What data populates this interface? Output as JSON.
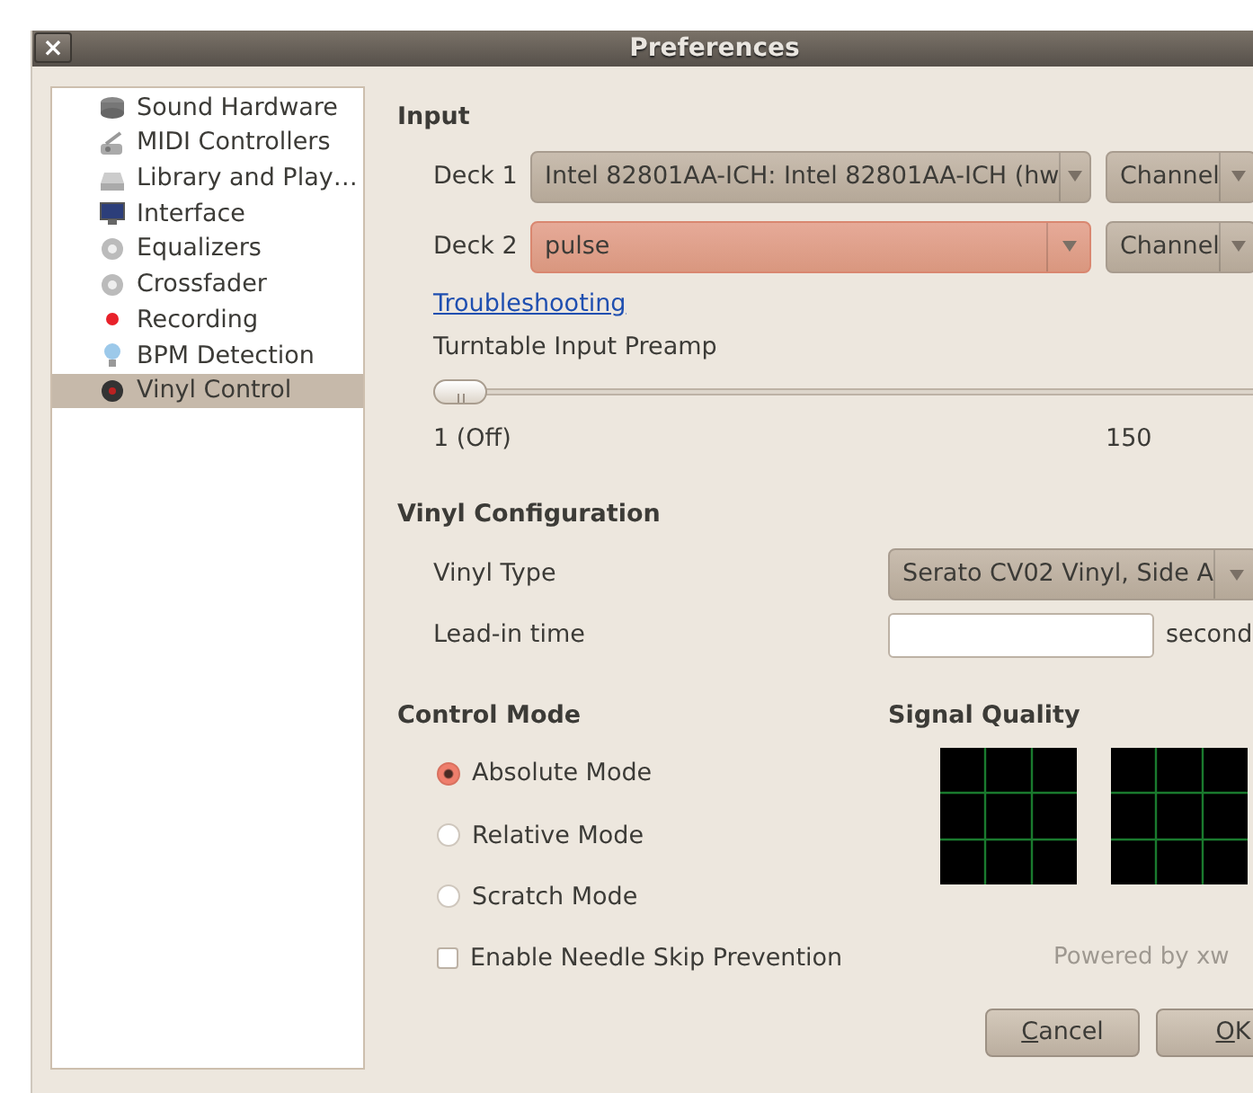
{
  "window": {
    "title": "Preferences",
    "close_label": "×"
  },
  "sidebar": {
    "items": [
      {
        "label": "Sound Hardware",
        "selected": false
      },
      {
        "label": "MIDI Controllers",
        "selected": false
      },
      {
        "label": "Library and Play…",
        "selected": false
      },
      {
        "label": "Interface",
        "selected": false
      },
      {
        "label": "Equalizers",
        "selected": false
      },
      {
        "label": "Crossfader",
        "selected": false
      },
      {
        "label": "Recording",
        "selected": false
      },
      {
        "label": "BPM Detection",
        "selected": false
      },
      {
        "label": "Vinyl Control",
        "selected": true
      }
    ]
  },
  "input": {
    "heading": "Input",
    "decks": [
      {
        "label": "Deck 1",
        "device": "Intel 82801AA-ICH: Intel 82801AA-ICH (hw",
        "error": false,
        "channels": "Channel"
      },
      {
        "label": "Deck 2",
        "device": "pulse",
        "error": true,
        "channels": "Channel"
      }
    ],
    "link": "Troubleshooting",
    "preamp": {
      "label": "Turntable Input Preamp",
      "level": 0,
      "min_label": "1 (Off)",
      "mid_label": "150"
    }
  },
  "vinyl_configuration": {
    "heading": "Vinyl Configuration",
    "vinyl_type": {
      "label": "Vinyl Type",
      "value": "Serato CV02 Vinyl, Side A"
    },
    "lead_in": {
      "label": "Lead-in time",
      "unit": "second"
    }
  },
  "control_mode": {
    "heading": "Control Mode",
    "options": [
      {
        "label": "Absolute Mode",
        "selected": true
      },
      {
        "label": "Relative Mode",
        "selected": false
      },
      {
        "label": "Scratch Mode",
        "selected": false
      }
    ],
    "needle_skip": {
      "label": "Enable Needle Skip Prevention",
      "checked": false
    }
  },
  "signal_quality": {
    "heading": "Signal Quality"
  },
  "powered_by": "Powered by xw",
  "buttons": [
    {
      "label": "Cancel",
      "first_letter_underlined": true
    },
    {
      "label": "OK",
      "first_letter_underlined": true
    }
  ]
}
